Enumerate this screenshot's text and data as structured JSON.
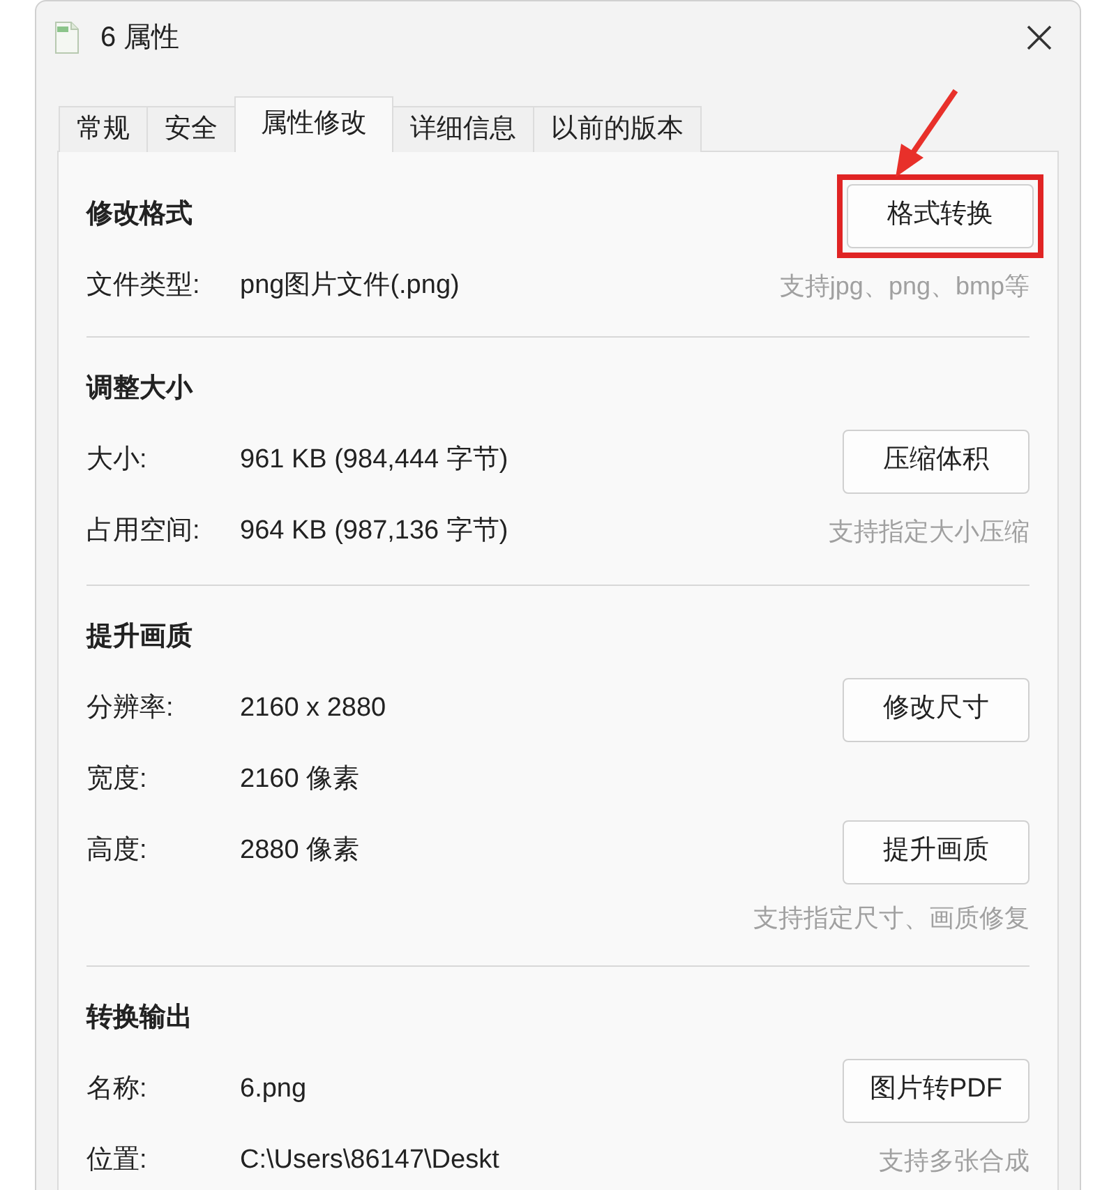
{
  "window": {
    "title": "6 属性"
  },
  "tabs": [
    {
      "label": "常规",
      "selected": false
    },
    {
      "label": "安全",
      "selected": false
    },
    {
      "label": "属性修改",
      "selected": true
    },
    {
      "label": "详细信息",
      "selected": false
    },
    {
      "label": "以前的版本",
      "selected": false
    }
  ],
  "sections": [
    {
      "title": "修改格式",
      "button": {
        "label": "格式转换",
        "highlighted": true
      },
      "rows": [
        {
          "label": "文件类型:",
          "value": "png图片文件(.png)",
          "note": "支持jpg、png、bmp等"
        }
      ]
    },
    {
      "title": "调整大小",
      "rows": [
        {
          "label": "大小:",
          "value": "961 KB (984,444 字节)",
          "button": {
            "label": "压缩体积",
            "highlighted": false
          }
        },
        {
          "label": "占用空间:",
          "value": "964 KB (987,136 字节)",
          "note": "支持指定大小压缩"
        }
      ]
    },
    {
      "title": "提升画质",
      "rows": [
        {
          "label": "分辨率:",
          "value": "2160 x 2880",
          "button": {
            "label": "修改尺寸",
            "highlighted": false
          }
        },
        {
          "label": "宽度:",
          "value": "2160 像素"
        },
        {
          "label": "高度:",
          "value": "2880 像素",
          "button": {
            "label": "提升画质",
            "highlighted": false
          }
        },
        {
          "note": "支持指定尺寸、画质修复"
        }
      ]
    },
    {
      "title": "转换输出",
      "rows": [
        {
          "label": "名称:",
          "value": "6.png",
          "button": {
            "label": "图片转PDF",
            "highlighted": false
          }
        },
        {
          "label": "位置:",
          "value": "C:\\Users\\86147\\Deskt",
          "note": "支持多张合成"
        }
      ]
    }
  ]
}
